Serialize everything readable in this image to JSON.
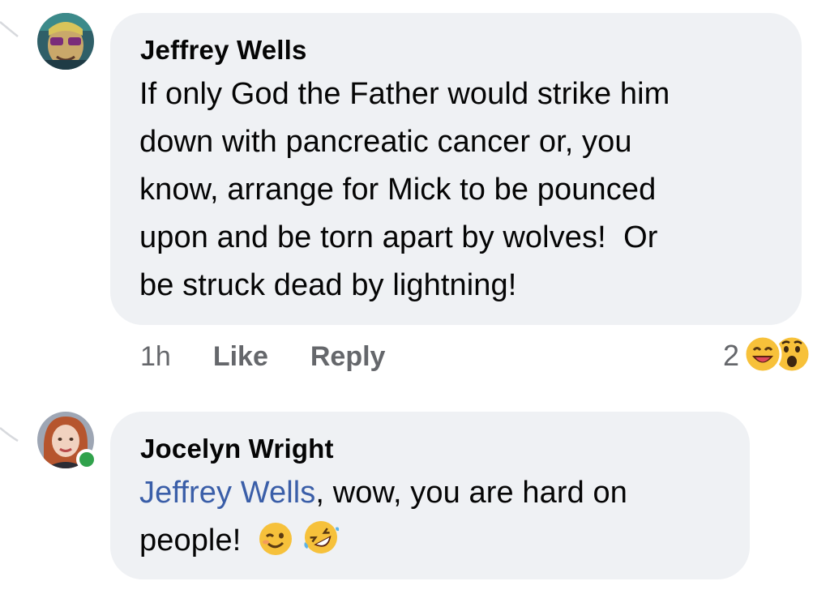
{
  "comments": [
    {
      "author": "Jeffrey Wells",
      "text_lines": [
        "If only God the Father would strike him",
        "down with pancreatic cancer or, you",
        "know, arrange for Mick to be pounced",
        "upon and be torn apart by wolves!  Or",
        "be struck dead by lightning!"
      ],
      "time": "1h",
      "like_label": "Like",
      "reply_label": "Reply",
      "reaction_count": "2",
      "reactions": [
        "haha-icon",
        "wow-icon"
      ]
    },
    {
      "author": "Jocelyn Wright",
      "mention": "Jeffrey Wells",
      "text_after_mention": ", wow, you are hard on",
      "text_line2": "people! ",
      "emojis": [
        "winking-face-icon",
        "rolling-laughing-icon"
      ],
      "online": true
    }
  ],
  "colors": {
    "bubble": "#eff1f4",
    "mention": "#3a5ea8",
    "meta": "#65676b",
    "online": "#31a24c"
  }
}
